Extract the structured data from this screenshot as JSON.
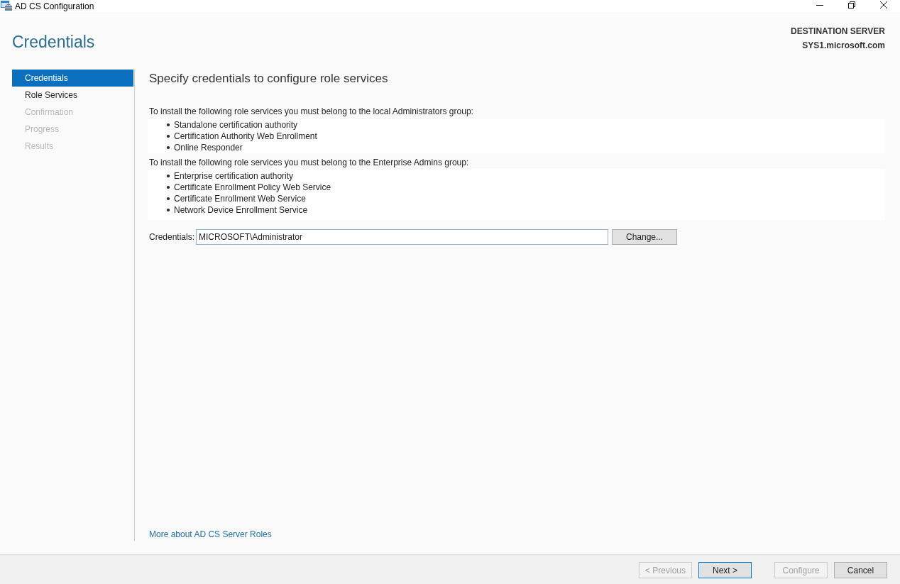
{
  "window": {
    "title": "AD CS Configuration"
  },
  "page_title": "Credentials",
  "destination_server": {
    "label": "DESTINATION SERVER",
    "name": "SYS1.microsoft.com"
  },
  "steps": [
    {
      "label": "Credentials",
      "selected": true,
      "disabled": false
    },
    {
      "label": "Role Services",
      "selected": false,
      "disabled": false
    },
    {
      "label": "Confirmation",
      "selected": false,
      "disabled": true
    },
    {
      "label": "Progress",
      "selected": false,
      "disabled": true
    },
    {
      "label": "Results",
      "selected": false,
      "disabled": true
    }
  ],
  "content": {
    "heading": "Specify credentials to configure role services",
    "groups": [
      {
        "intro": "To install the following role services you must belong to the local Administrators group:",
        "services": [
          "Standalone certification authority",
          "Certification Authority Web Enrollment",
          "Online Responder"
        ]
      },
      {
        "intro": "To install the following role services you must belong to the Enterprise Admins group:",
        "services": [
          "Enterprise certification authority",
          "Certificate Enrollment Policy Web Service",
          "Certificate Enrollment Web Service",
          "Network Device Enrollment Service"
        ]
      }
    ],
    "credentials": {
      "label": "Credentials:",
      "value": "MICROSOFT\\Administrator",
      "button": "Change..."
    },
    "link": "More about AD CS Server Roles"
  },
  "footer": {
    "navigation": [
      {
        "label": "< Previous",
        "disabled": true,
        "default": false
      },
      {
        "label": "Next >",
        "disabled": false,
        "default": true
      }
    ],
    "actions": [
      {
        "label": "Configure",
        "disabled": true,
        "default": false
      },
      {
        "label": "Cancel",
        "disabled": false,
        "default": false
      }
    ]
  }
}
